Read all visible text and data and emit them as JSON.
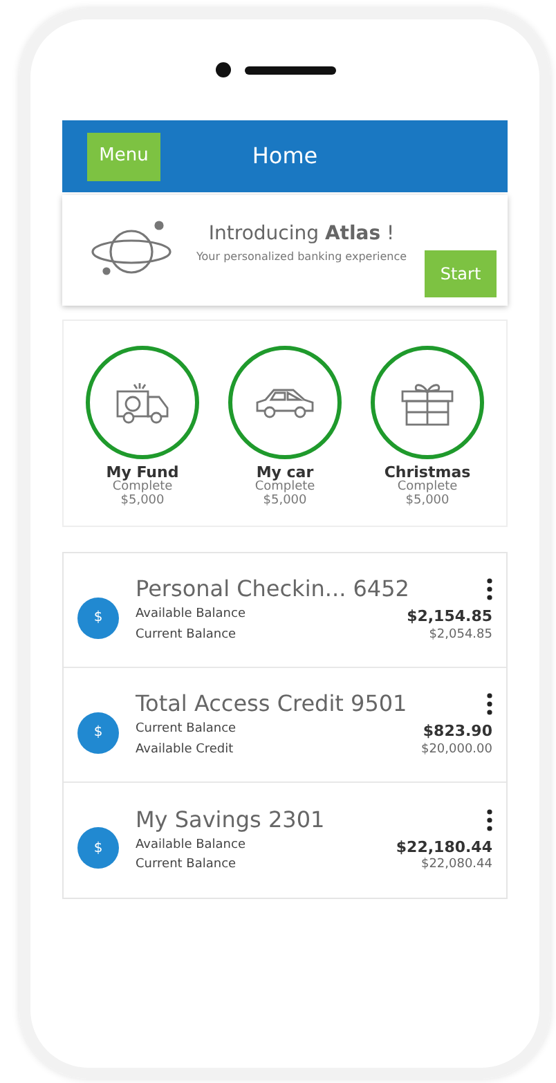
{
  "header": {
    "menu_button": "Menu",
    "title": "Home"
  },
  "banner": {
    "title_prefix": "Introducing ",
    "title_brand": "Atlas",
    "title_suffix": " !",
    "subtitle": "Your personalized banking experience",
    "button": "Start"
  },
  "goals": [
    {
      "kind": "van",
      "name": "My Fund",
      "status": "Complete",
      "amount": "$5,000"
    },
    {
      "kind": "car",
      "name": "My car",
      "status": "Complete",
      "amount": "$5,000"
    },
    {
      "kind": "gift",
      "name": "Christmas",
      "status": "Complete",
      "amount": "$5,000"
    }
  ],
  "accounts": [
    {
      "name": "Personal Checkin... 6452",
      "icon": "$",
      "line_1_label": "Available Balance",
      "line_1_value": "$2,154.85",
      "line_2_label": "Current Balance",
      "line_2_value": "$2,054.85"
    },
    {
      "name": "Total Access Credit 9501",
      "icon": "$",
      "line_1_label": "Current Balance",
      "line_1_value": "$823.90",
      "line_2_label": "Available Credit",
      "line_2_value": "$20,000.00"
    },
    {
      "name": "My Savings 2301",
      "icon": "$",
      "line_1_label": "Available Balance",
      "line_1_value": "$22,180.44",
      "line_2_label": "Current Balance",
      "line_2_value": "$22,080.44"
    }
  ]
}
